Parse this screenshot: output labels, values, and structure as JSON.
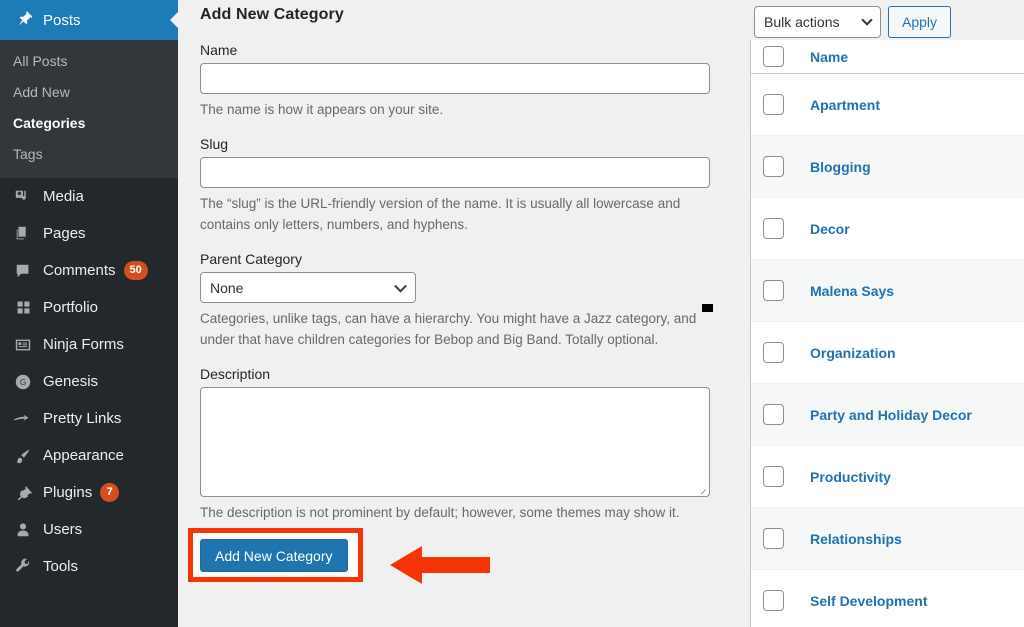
{
  "sidebar": {
    "active": {
      "label": "Posts",
      "icon": "pin-icon",
      "accent": "#1d7cb8"
    },
    "submenu": [
      {
        "label": "All Posts",
        "current": false
      },
      {
        "label": "Add New",
        "current": false
      },
      {
        "label": "Categories",
        "current": true
      },
      {
        "label": "Tags",
        "current": false
      }
    ],
    "items": [
      {
        "label": "Media",
        "icon": "media-icon",
        "badge": ""
      },
      {
        "label": "Pages",
        "icon": "pages-icon",
        "badge": ""
      },
      {
        "label": "Comments",
        "icon": "comments-icon",
        "badge": "50"
      },
      {
        "label": "Portfolio",
        "icon": "portfolio-icon",
        "badge": ""
      },
      {
        "label": "Ninja Forms",
        "icon": "forms-icon",
        "badge": ""
      },
      {
        "label": "Genesis",
        "icon": "genesis-icon",
        "badge": ""
      },
      {
        "label": "Pretty Links",
        "icon": "pretty-links-icon",
        "badge": ""
      },
      {
        "label": "Appearance",
        "icon": "brush-icon",
        "badge": ""
      },
      {
        "label": "Plugins",
        "icon": "plug-icon",
        "badge": "7"
      },
      {
        "label": "Users",
        "icon": "user-icon",
        "badge": ""
      },
      {
        "label": "Tools",
        "icon": "wrench-icon",
        "badge": ""
      }
    ],
    "badge_color": "#d54e21"
  },
  "form": {
    "title": "Add New Category",
    "name": {
      "label": "Name",
      "value": "",
      "placeholder": "",
      "help": "The name is how it appears on your site."
    },
    "slug": {
      "label": "Slug",
      "value": "",
      "placeholder": "",
      "help": "The “slug” is the URL-friendly version of the name. It is usually all lowercase and contains only letters, numbers, and hyphens."
    },
    "parent": {
      "label": "Parent Category",
      "selected": "None",
      "options": [
        "None"
      ],
      "help": "Categories, unlike tags, can have a hierarchy. You might have a Jazz category, and under that have children categories for Bebop and Big Band. Totally optional."
    },
    "description": {
      "label": "Description",
      "value": "",
      "placeholder": "",
      "help": "The description is not prominent by default; however, some themes may show it."
    },
    "submit_label": "Add New Category",
    "submit_color": "#2075b0",
    "highlight_color": "#f5340a"
  },
  "list": {
    "bulk_actions": {
      "selected": "Bulk actions",
      "options": [
        "Bulk actions"
      ]
    },
    "apply_label": "Apply",
    "column_header": "Name",
    "link_color": "#2271b1",
    "rows": [
      {
        "name": "Apartment"
      },
      {
        "name": "Blogging"
      },
      {
        "name": "Decor"
      },
      {
        "name": "Malena Says"
      },
      {
        "name": "Organization"
      },
      {
        "name": "Party and Holiday Decor"
      },
      {
        "name": "Productivity"
      },
      {
        "name": "Relationships"
      },
      {
        "name": "Self Development"
      }
    ]
  }
}
